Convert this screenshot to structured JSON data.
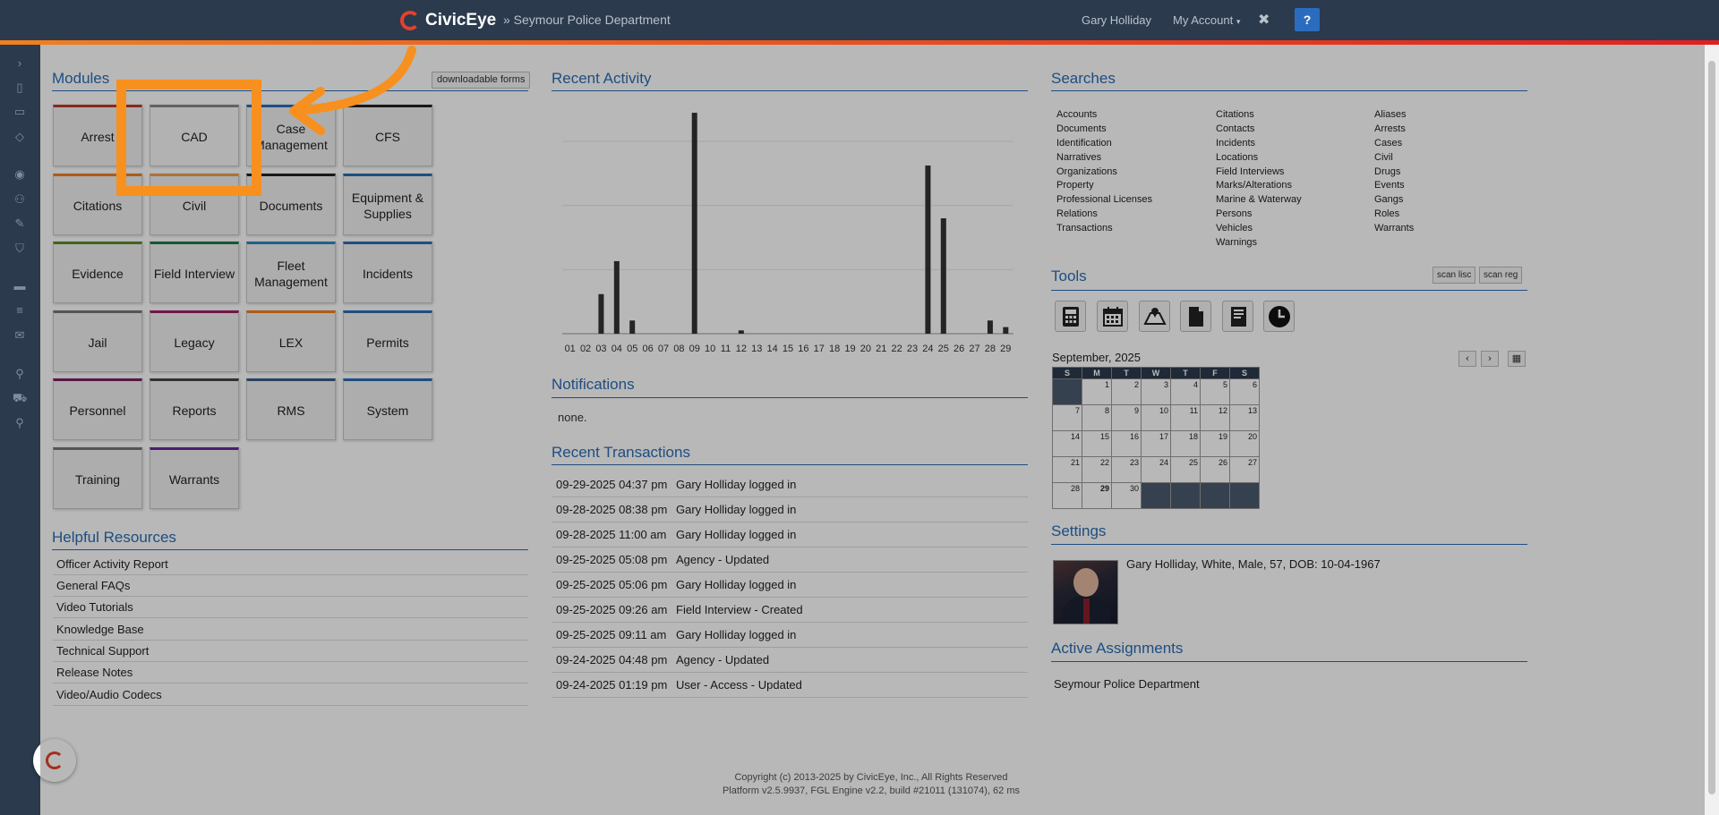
{
  "header": {
    "brand": "CivicEye",
    "department": "» Seymour Police Department",
    "user": "Gary Holliday",
    "my_account": "My Account",
    "close": "✖",
    "help": "?"
  },
  "modules": {
    "title": "Modules",
    "downloadable_forms": "downloadable forms",
    "items": [
      {
        "label": "Arrest",
        "color": "#c0392b"
      },
      {
        "label": "CAD",
        "color": "#888888"
      },
      {
        "label": "Case Management",
        "color": "#2a6db5"
      },
      {
        "label": "CFS",
        "color": "#222222"
      },
      {
        "label": "Citations",
        "color": "#f08020"
      },
      {
        "label": "Civil",
        "color": "#f0a050"
      },
      {
        "label": "Documents",
        "color": "#222222"
      },
      {
        "label": "Equipment & Supplies",
        "color": "#2a6db5"
      },
      {
        "label": "Evidence",
        "color": "#5a8a2a"
      },
      {
        "label": "Field Interview",
        "color": "#1e7a4a"
      },
      {
        "label": "Fleet Management",
        "color": "#2a8ac0"
      },
      {
        "label": "Incidents",
        "color": "#2a6db5"
      },
      {
        "label": "Jail",
        "color": "#777777"
      },
      {
        "label": "Legacy",
        "color": "#a02060"
      },
      {
        "label": "LEX",
        "color": "#f08020"
      },
      {
        "label": "Permits",
        "color": "#2a6db5"
      },
      {
        "label": "Personnel",
        "color": "#7a2060"
      },
      {
        "label": "Reports",
        "color": "#444444"
      },
      {
        "label": "RMS",
        "color": "#3a5a8a"
      },
      {
        "label": "System",
        "color": "#2a6db5"
      },
      {
        "label": "Training",
        "color": "#777777"
      },
      {
        "label": "Warrants",
        "color": "#6a2a9a"
      }
    ]
  },
  "resources": {
    "title": "Helpful Resources",
    "items": [
      "Officer Activity Report",
      "General FAQs",
      "Video Tutorials",
      "Knowledge Base",
      "Technical Support",
      "Release Notes",
      "Video/Audio Codecs"
    ]
  },
  "activity": {
    "title": "Recent Activity"
  },
  "chart_data": {
    "type": "bar",
    "categories": [
      "01",
      "02",
      "03",
      "04",
      "05",
      "06",
      "07",
      "08",
      "09",
      "10",
      "11",
      "12",
      "13",
      "14",
      "15",
      "16",
      "17",
      "18",
      "19",
      "20",
      "21",
      "22",
      "23",
      "24",
      "25",
      "26",
      "27",
      "28",
      "29"
    ],
    "values": [
      0,
      0,
      12,
      22,
      4,
      0,
      0,
      0,
      67,
      0,
      0,
      1,
      0,
      0,
      0,
      0,
      0,
      0,
      0,
      0,
      0,
      0,
      0,
      51,
      35,
      0,
      0,
      4,
      2
    ],
    "ylim": [
      0,
      70
    ],
    "grid": true,
    "color": "#333333"
  },
  "notifications": {
    "title": "Notifications",
    "empty": "none."
  },
  "transactions": {
    "title": "Recent Transactions",
    "rows": [
      {
        "date": "09-29-2025 04:37 pm",
        "desc": "Gary Holliday logged in"
      },
      {
        "date": "09-28-2025 08:38 pm",
        "desc": "Gary Holliday logged in"
      },
      {
        "date": "09-28-2025 11:00 am",
        "desc": "Gary Holliday logged in"
      },
      {
        "date": "09-25-2025 05:08 pm",
        "desc": "Agency - Updated"
      },
      {
        "date": "09-25-2025 05:06 pm",
        "desc": "Gary Holliday logged in"
      },
      {
        "date": "09-25-2025 09:26 am",
        "desc": "Field Interview - Created"
      },
      {
        "date": "09-25-2025 09:11 am",
        "desc": "Gary Holliday logged in"
      },
      {
        "date": "09-24-2025 04:48 pm",
        "desc": "Agency - Updated"
      },
      {
        "date": "09-24-2025 01:19 pm",
        "desc": "User - Access - Updated"
      }
    ]
  },
  "searches": {
    "title": "Searches",
    "col1": [
      "Accounts",
      "Documents",
      "Identification",
      "Narratives",
      "Organizations",
      "Property",
      "Professional Licenses",
      "Relations",
      "Transactions"
    ],
    "col2": [
      "Citations",
      "Contacts",
      "Incidents",
      "Locations",
      "Field Interviews",
      "Marks/Alterations",
      "Marine & Waterway",
      "Persons",
      "Vehicles",
      "Warnings"
    ],
    "col3": [
      "Aliases",
      "Arrests",
      "Cases",
      "Civil",
      "Drugs",
      "Events",
      "Gangs",
      "Roles",
      "Warrants"
    ]
  },
  "tools": {
    "title": "Tools",
    "scan_lisc": "scan lisc",
    "scan_reg": "scan reg",
    "icons": [
      "calculator-icon",
      "calendar-icon",
      "map-icon",
      "document-icon",
      "book-icon",
      "clock-icon"
    ]
  },
  "calendar": {
    "month": "September, 2025",
    "prev": "‹",
    "next": "›",
    "grid_button": "▦",
    "weekdays": [
      "S",
      "M",
      "T",
      "W",
      "T",
      "F",
      "S"
    ],
    "weeks": [
      [
        "",
        "1",
        "2",
        "3",
        "4",
        "5",
        "6"
      ],
      [
        "7",
        "8",
        "9",
        "10",
        "11",
        "12",
        "13"
      ],
      [
        "14",
        "15",
        "16",
        "17",
        "18",
        "19",
        "20"
      ],
      [
        "21",
        "22",
        "23",
        "24",
        "25",
        "26",
        "27"
      ],
      [
        "28",
        "29",
        "30",
        "",
        "",
        "",
        ""
      ]
    ],
    "today": "29"
  },
  "settings": {
    "title": "Settings",
    "profile": "Gary Holliday, White, Male, 57, DOB: 10-04-1967"
  },
  "assignments": {
    "title": "Active Assignments",
    "item": "Seymour Police Department"
  },
  "footer": {
    "line1": "Copyright (c) 2013-2025 by CivicEye, Inc., All Rights Reserved",
    "line2": "Platform v2.5.9937, FGL Engine v2.2, build #21011 (131074), 62 ms"
  }
}
